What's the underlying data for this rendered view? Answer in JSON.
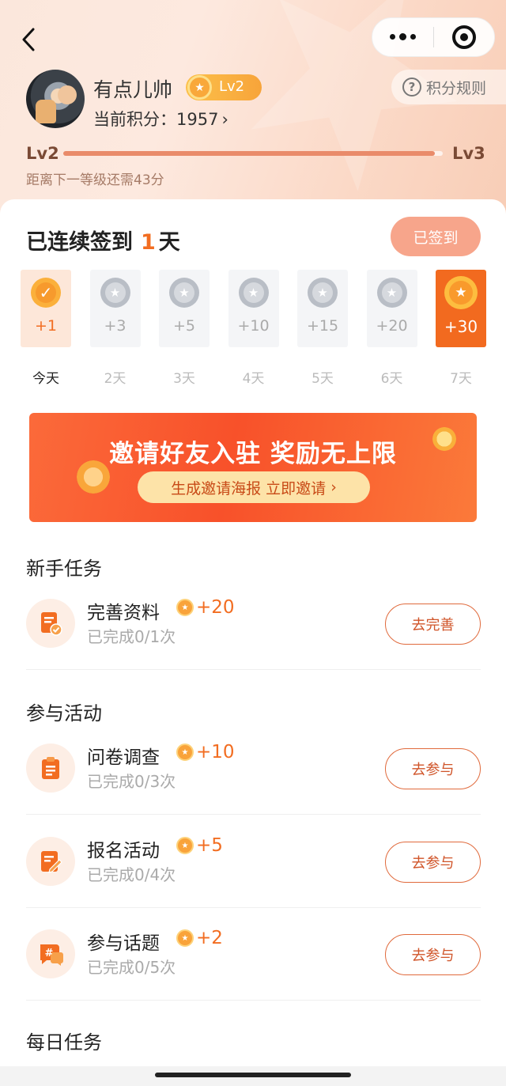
{
  "header": {
    "user_name": "有点儿帅",
    "level_badge": "Lv2",
    "points_label": "当前积分：",
    "points_value": "1957",
    "rules_label": "积分规则",
    "current_level": "Lv2",
    "next_level": "Lv3",
    "level_progress_pct": 98,
    "level_hint": "距离下一等级还需43分"
  },
  "signin": {
    "title_prefix": "已连续签到",
    "streak_days": "1",
    "title_suffix": "天",
    "button_label": "已签到",
    "days": [
      {
        "reward": "+1",
        "label": "今天",
        "state": "done"
      },
      {
        "reward": "+3",
        "label": "2天",
        "state": "pending"
      },
      {
        "reward": "+5",
        "label": "3天",
        "state": "pending"
      },
      {
        "reward": "+10",
        "label": "4天",
        "state": "pending"
      },
      {
        "reward": "+15",
        "label": "5天",
        "state": "pending"
      },
      {
        "reward": "+20",
        "label": "6天",
        "state": "pending"
      },
      {
        "reward": "+30",
        "label": "7天",
        "state": "bonus"
      }
    ]
  },
  "invite": {
    "title": "邀请好友入驻  奖励无上限",
    "cta": "生成邀请海报 立即邀请",
    "cta_arrow": "›"
  },
  "sections": {
    "newbie": "新手任务",
    "activity": "参与活动",
    "daily": "每日任务"
  },
  "tasks": [
    {
      "title": "完善资料",
      "reward": "+20",
      "progress": "已完成0/1次",
      "action": "去完善",
      "icon": "profile-doc-icon"
    },
    {
      "title": "问卷调查",
      "reward": "+10",
      "progress": "已完成0/3次",
      "action": "去参与",
      "icon": "clipboard-icon"
    },
    {
      "title": "报名活动",
      "reward": "+5",
      "progress": "已完成0/4次",
      "action": "去参与",
      "icon": "edit-form-icon"
    },
    {
      "title": "参与话题",
      "reward": "+2",
      "progress": "已完成0/5次",
      "action": "去参与",
      "icon": "topic-hashtag-icon"
    }
  ],
  "colors": {
    "accent": "#f26d21",
    "signed_button": "#f7a58b",
    "banner": "#f8512a"
  }
}
